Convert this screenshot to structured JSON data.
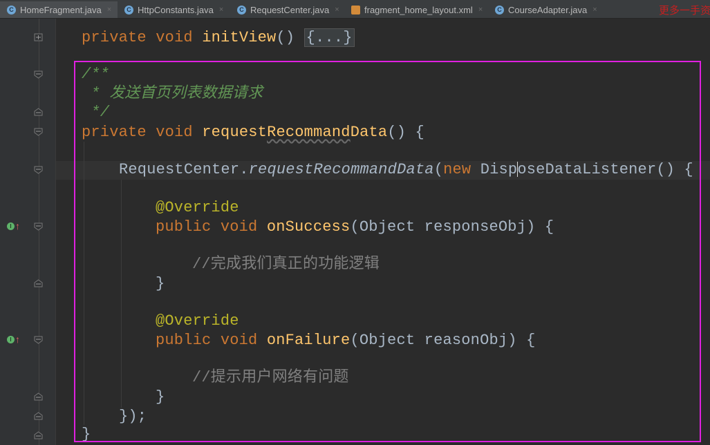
{
  "tabs": [
    {
      "label": "HomeFragment.java",
      "icon": "class-icon",
      "active": true
    },
    {
      "label": "HttpConstants.java",
      "icon": "class-icon",
      "active": false
    },
    {
      "label": "RequestCenter.java",
      "icon": "class-icon",
      "active": false
    },
    {
      "label": "fragment_home_layout.xml",
      "icon": "xml-icon",
      "active": false
    },
    {
      "label": "CourseAdapter.java",
      "icon": "class-icon",
      "active": false
    }
  ],
  "tab_icon_letter": "C",
  "close_glyph": "×",
  "watermark": "更多一手资",
  "code": {
    "l1": {
      "kw": "private void ",
      "fn": "initView",
      "rest": "() ",
      "folded": "{...}"
    },
    "doc1": "/**",
    "doc2": " * 发送首页列表数据请求",
    "doc3": " */",
    "l2": {
      "kw": "private void ",
      "fn_a": "request",
      "fn_b": "Recommand",
      "fn_c": "Data",
      "rest": "() {"
    },
    "l3": {
      "cls": "RequestCenter.",
      "method": "requestRecommandData",
      "paren": "(",
      "kw": "new ",
      "type_a": "Disp",
      "type_b": "oseDataListener() {"
    },
    "ann1": "@Override",
    "l4": {
      "kw": "public void ",
      "fn": "onSuccess",
      "rest": "(Object responseObj) {"
    },
    "cm1": "//完成我们真正的功能逻辑",
    "close1": "}",
    "ann2": "@Override",
    "l5": {
      "kw": "public void ",
      "fn": "onFailure",
      "rest": "(Object reasonObj) {"
    },
    "cm2": "//提示用户网络有问题",
    "close2": "}",
    "close3": "});",
    "close4": "}"
  },
  "gutter": {
    "implements_letter": "I",
    "up_arrow": "↑"
  },
  "colors": {
    "keyword": "#cc7832",
    "method": "#ffc66d",
    "doc": "#629755",
    "comment": "#808080",
    "annotation": "#bbb529",
    "highlight": "#e020e0"
  }
}
